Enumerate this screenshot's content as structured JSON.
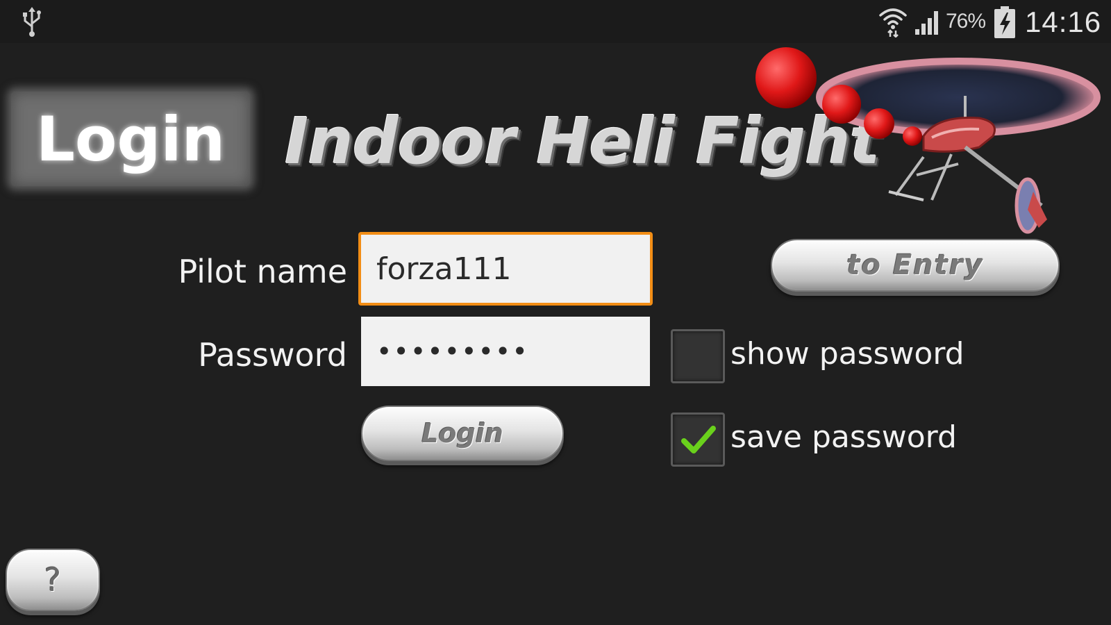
{
  "status_bar": {
    "usb_icon": "usb-icon",
    "wifi_icon": "wifi-icon",
    "signal_icon": "cell-signal-icon",
    "battery_percent": "76%",
    "battery_icon": "battery-charging-icon",
    "time": "14:16"
  },
  "header": {
    "badge_label": "Login",
    "app_title": "Indoor Heli Fight",
    "artwork": "helicopter-with-red-balls-illustration"
  },
  "form": {
    "pilot_name_label": "Pilot name",
    "pilot_name_value": "forza111",
    "password_label": "Password",
    "password_value": "•••••••••",
    "login_button": "Login",
    "to_entry_button": "to Entry",
    "show_password": {
      "label": "show password",
      "checked": false
    },
    "save_password": {
      "label": "save password",
      "checked": true
    }
  },
  "help_button": "?",
  "colors": {
    "background": "#1f1f1f",
    "focus_border": "#f28d15",
    "check_green": "#6ad11c"
  }
}
